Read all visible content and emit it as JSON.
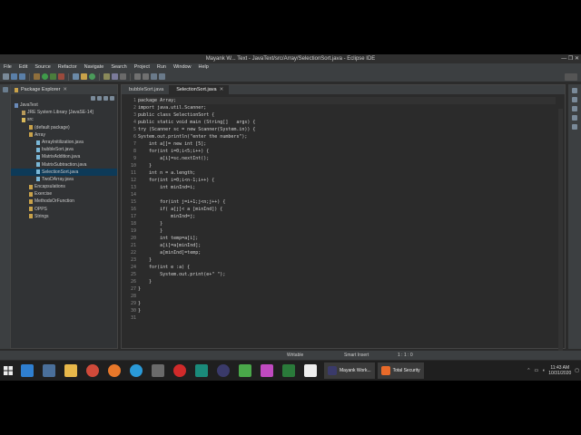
{
  "window": {
    "title": "Mayank W... Text - JavaText/src/Array/SelectionSort.java - Eclipse IDE",
    "controls": "—  ❐  ✕"
  },
  "menu": [
    "File",
    "Edit",
    "Source",
    "Refactor",
    "Navigate",
    "Search",
    "Project",
    "Run",
    "Window",
    "Help"
  ],
  "package_explorer": {
    "tab_label": "Package Explorer",
    "tree": [
      {
        "label": "JavaText",
        "indent": 0,
        "icon": "project-icon",
        "selected": false
      },
      {
        "label": "JRE System Library [JavaSE-14]",
        "indent": 1,
        "icon": "library-icon",
        "selected": false
      },
      {
        "label": "src",
        "indent": 1,
        "icon": "folder-icon",
        "selected": false
      },
      {
        "label": "(default package)",
        "indent": 2,
        "icon": "package-icon",
        "selected": false
      },
      {
        "label": "Array",
        "indent": 2,
        "icon": "package-icon",
        "selected": false
      },
      {
        "label": "ArrayInitilization.java",
        "indent": 3,
        "icon": "java-file-icon",
        "selected": false
      },
      {
        "label": "bubbleSort.java",
        "indent": 3,
        "icon": "java-file-icon",
        "selected": false
      },
      {
        "label": "MatrixAddition.java",
        "indent": 3,
        "icon": "java-file-icon",
        "selected": false
      },
      {
        "label": "MatrixSubtraction.java",
        "indent": 3,
        "icon": "java-file-icon",
        "selected": false
      },
      {
        "label": "SelectionSort.java",
        "indent": 3,
        "icon": "java-file-icon",
        "selected": true
      },
      {
        "label": "TwoDArray.java",
        "indent": 3,
        "icon": "java-file-icon",
        "selected": false
      },
      {
        "label": "Encapsulations",
        "indent": 2,
        "icon": "package-icon",
        "selected": false
      },
      {
        "label": "Exercise",
        "indent": 2,
        "icon": "package-icon",
        "selected": false
      },
      {
        "label": "MethodsOrFunction",
        "indent": 2,
        "icon": "package-icon",
        "selected": false
      },
      {
        "label": "OPPS",
        "indent": 2,
        "icon": "package-icon",
        "selected": false
      },
      {
        "label": "Strings",
        "indent": 2,
        "icon": "package-icon",
        "selected": false
      }
    ]
  },
  "editor": {
    "tabs": [
      {
        "label": "bubbleSort.java",
        "active": false
      },
      {
        "label": "SelectionSort.java",
        "active": true
      }
    ],
    "lines": [
      "package Array;",
      "import java.util.Scanner;",
      "public class SelectionSort {",
      "public static void main (String[]   args) {",
      "try (Scanner sc = new Scanner(System.in)) {",
      "System.out.println(\"enter the numbers\");",
      "    int a[]= new int [5];",
      "    for(int i=0;i<5;i++) {",
      "        a[i]=sc.nextInt();",
      "    }",
      "    int n = a.length;",
      "    for(int i=0;i<n-1;i++) {",
      "        int minInd=i;",
      "",
      "        for(int j=i+1;j<n;j++) {",
      "        if( a[j]< a [minInd]) {",
      "            minInd=j;",
      "        }",
      "        }",
      "        int temp=a[i];",
      "        a[i]=a[minInd];",
      "        a[minInd]=temp;",
      "    }",
      "    for(int e :a) {",
      "        System.out.print(e+\" \");",
      "    }",
      "}",
      "",
      "}",
      "}",
      ""
    ]
  },
  "statusbar": {
    "mode": "Writable",
    "insert": "Smart Insert",
    "position": "1 : 1 : 0"
  },
  "taskbar": {
    "tasks": [
      {
        "label": "Mayank Work...",
        "icon": "eclipse-icon"
      },
      {
        "label": "Total Security",
        "icon": "quickheal-icon"
      }
    ],
    "time": "11:43 AM",
    "date": "10/31/2020"
  }
}
